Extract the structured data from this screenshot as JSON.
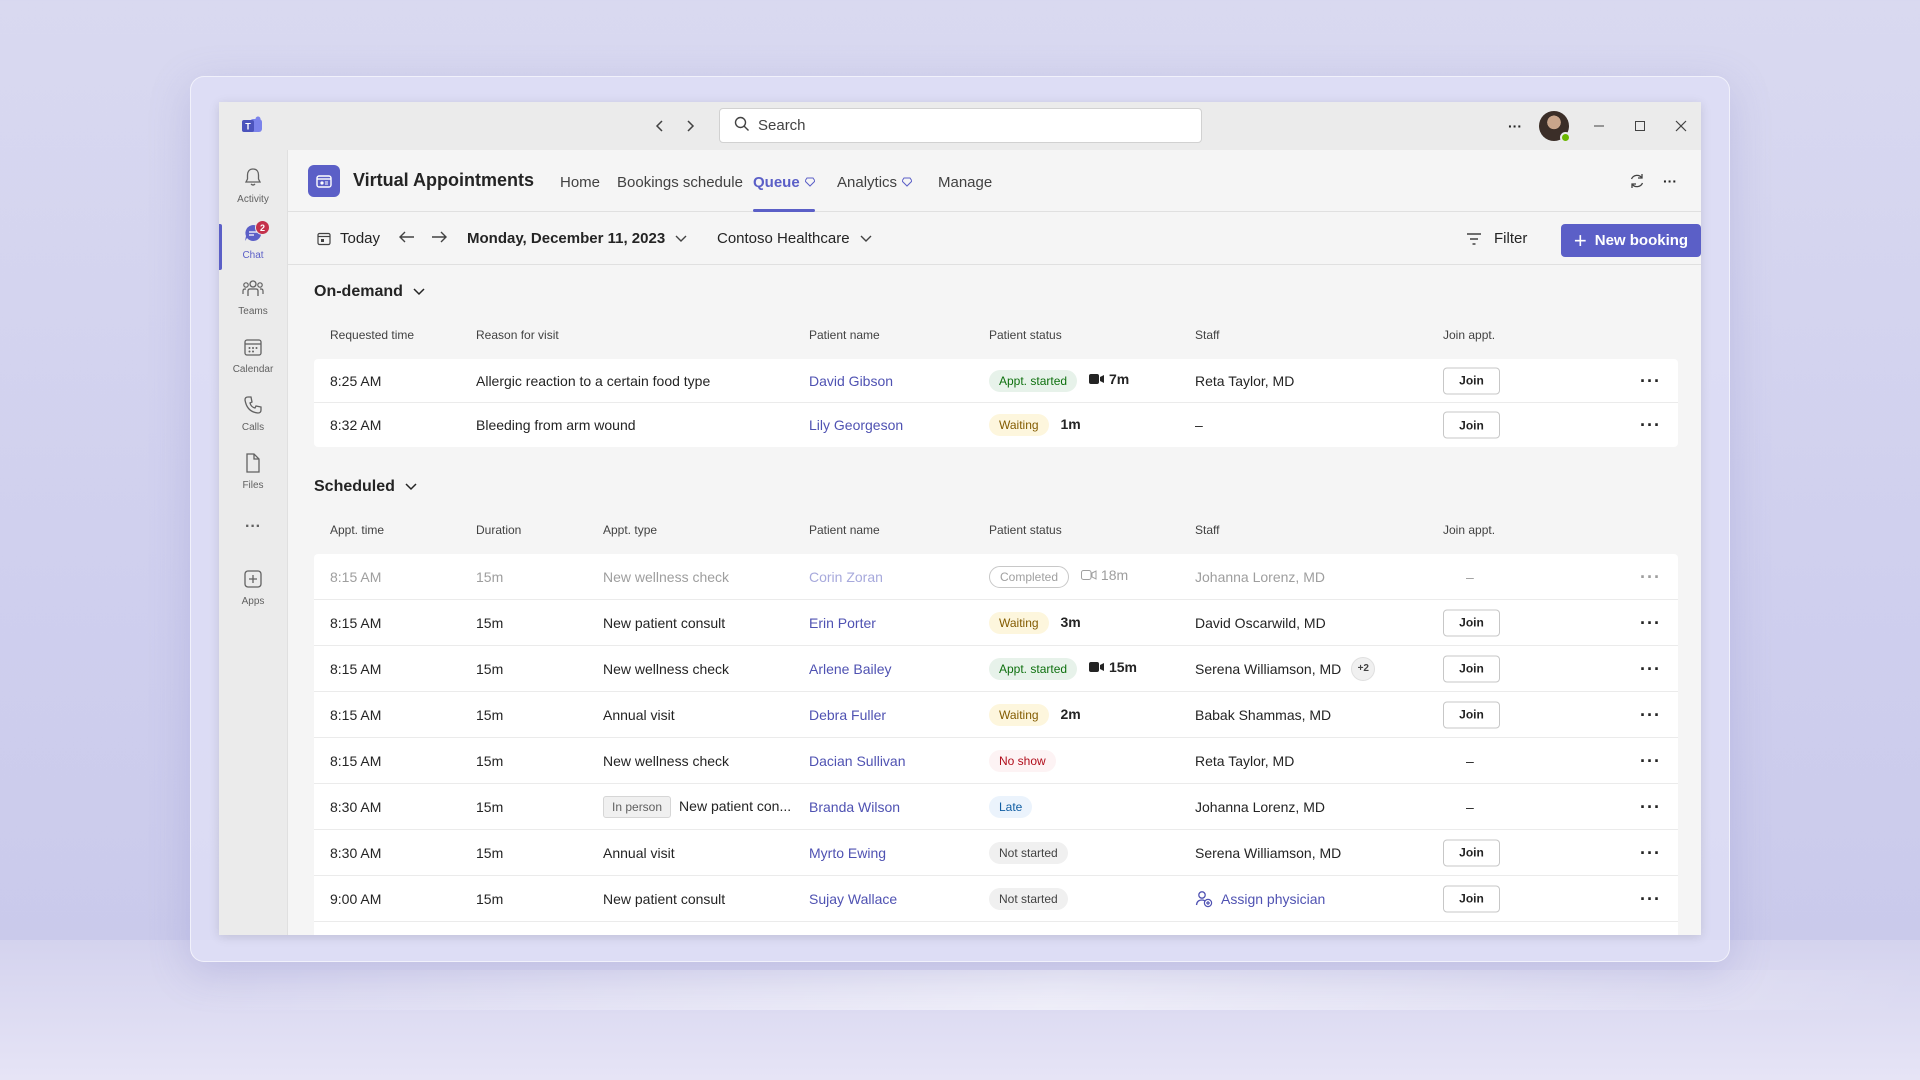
{
  "titlebar": {
    "search_placeholder": "Search",
    "more_label": "···"
  },
  "rail": {
    "items": [
      {
        "label": "Activity",
        "icon": "bell-icon"
      },
      {
        "label": "Chat",
        "icon": "chat-icon",
        "badge": "2"
      },
      {
        "label": "Teams",
        "icon": "teams-icon"
      },
      {
        "label": "Calendar",
        "icon": "calendar-icon"
      },
      {
        "label": "Calls",
        "icon": "phone-icon"
      },
      {
        "label": "Files",
        "icon": "file-icon"
      },
      {
        "label": "Apps",
        "icon": "add-app-icon"
      }
    ],
    "more_label": "···"
  },
  "app": {
    "title": "Virtual Appointments",
    "tabs": [
      "Home",
      "Bookings schedule",
      "Queue",
      "Analytics",
      "Manage"
    ],
    "active_tab": "Queue",
    "accent": "#5b5fc7"
  },
  "toolbar": {
    "today": "Today",
    "date": "Monday, December 11, 2023",
    "org": "Contoso Healthcare",
    "filter": "Filter",
    "new_booking": "New booking"
  },
  "ondemand": {
    "title": "On-demand",
    "headers": [
      "Requested time",
      "Reason for visit",
      "Patient name",
      "Patient status",
      "Staff",
      "Join appt."
    ],
    "rows": [
      {
        "time": "8:25 AM",
        "reason": "Allergic reaction to a certain food type",
        "patient": "David Gibson",
        "status": "Appt. started",
        "wait": "7m",
        "staff": "Reta Taylor, MD",
        "join": "Join"
      },
      {
        "time": "8:32 AM",
        "reason": "Bleeding from arm wound",
        "patient": "Lily Georgeson",
        "status": "Waiting",
        "wait": "1m",
        "staff": "–",
        "join": "Join"
      }
    ]
  },
  "scheduled": {
    "title": "Scheduled",
    "headers": [
      "Appt. time",
      "Duration",
      "Appt. type",
      "Patient name",
      "Patient status",
      "Staff",
      "Join appt."
    ],
    "rows": [
      {
        "time": "8:15 AM",
        "duration": "15m",
        "type": "New wellness check",
        "patient": "Corin Zoran",
        "status": "Completed",
        "wait": "18m",
        "staff": "Johanna Lorenz, MD",
        "join": "–"
      },
      {
        "time": "8:15 AM",
        "duration": "15m",
        "type": "New patient consult",
        "patient": "Erin Porter",
        "status": "Waiting",
        "wait": "3m",
        "staff": "David Oscarwild, MD",
        "join": "Join"
      },
      {
        "time": "8:15 AM",
        "duration": "15m",
        "type": "New wellness check",
        "patient": "Arlene Bailey",
        "status": "Appt. started",
        "wait": "15m",
        "staff": "Serena Williamson, MD",
        "staff_extra": "+2",
        "join": "Join"
      },
      {
        "time": "8:15 AM",
        "duration": "15m",
        "type": "Annual visit",
        "patient": "Debra Fuller",
        "status": "Waiting",
        "wait": "2m",
        "staff": "Babak Shammas, MD",
        "join": "Join"
      },
      {
        "time": "8:15 AM",
        "duration": "15m",
        "type": "New wellness check",
        "patient": "Dacian Sullivan",
        "status": "No show",
        "staff": "Reta Taylor, MD",
        "join": "–"
      },
      {
        "time": "8:30 AM",
        "duration": "15m",
        "type_tag": "In person",
        "type": "New patient con...",
        "patient": "Branda Wilson",
        "status": "Late",
        "staff": "Johanna Lorenz, MD",
        "join": "–"
      },
      {
        "time": "8:30 AM",
        "duration": "15m",
        "type": "Annual visit",
        "patient": "Myrto Ewing",
        "status": "Not started",
        "staff": "Serena Williamson, MD",
        "join": "Join"
      },
      {
        "time": "9:00 AM",
        "duration": "15m",
        "type": "New patient consult",
        "patient": "Sujay Wallace",
        "status": "Not started",
        "staff": "Assign physician",
        "join": "Join"
      }
    ]
  }
}
